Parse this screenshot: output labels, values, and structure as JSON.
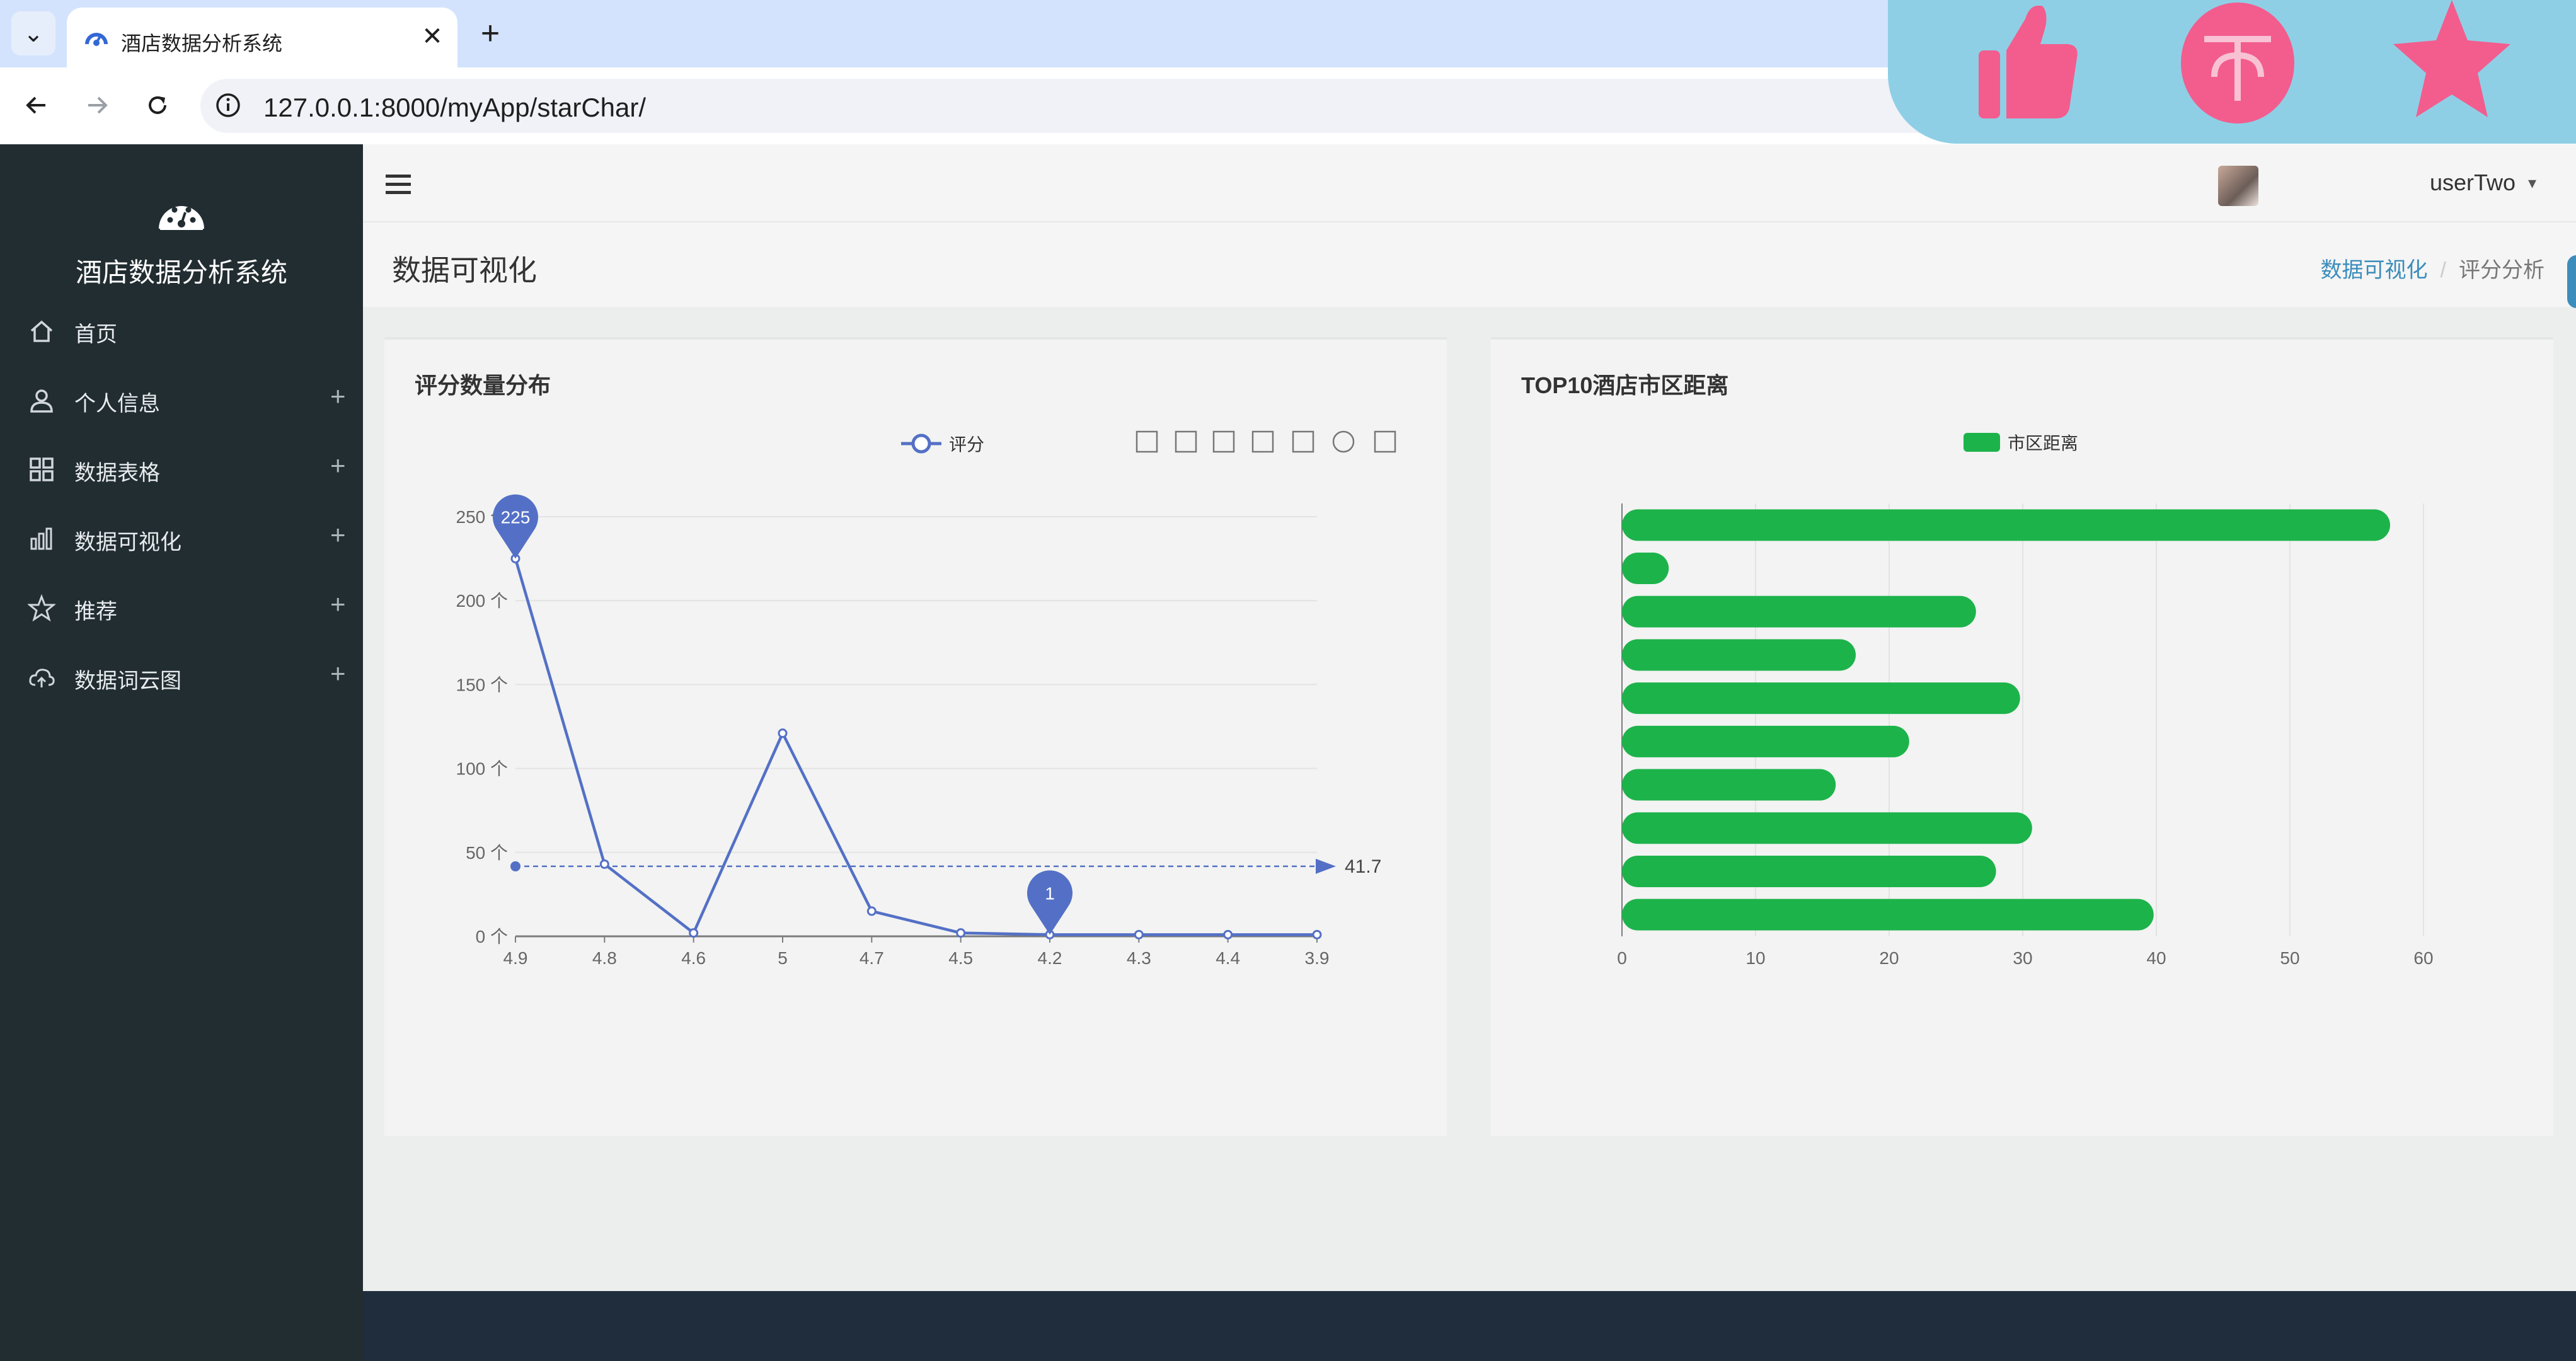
{
  "browser": {
    "tab_title": "酒店数据分析系统",
    "tab_close": "✕",
    "new_tab": "+",
    "url": "127.0.0.1:8000/myApp/starChar/"
  },
  "sidebar": {
    "brand": "酒店数据分析系统",
    "items": [
      {
        "label": "首页",
        "icon": "home-icon",
        "expandable": false
      },
      {
        "label": "个人信息",
        "icon": "user-icon",
        "expandable": true
      },
      {
        "label": "数据表格",
        "icon": "grid-icon",
        "expandable": true
      },
      {
        "label": "数据可视化",
        "icon": "bar-chart-icon",
        "expandable": true
      },
      {
        "label": "推荐",
        "icon": "star-icon",
        "expandable": true
      },
      {
        "label": "数据词云图",
        "icon": "cloud-upload-icon",
        "expandable": true
      }
    ],
    "plus": "+"
  },
  "header": {
    "username": "userTwo",
    "caret": "▾"
  },
  "content": {
    "page_title": "数据可视化",
    "breadcrumb": [
      "数据可视化",
      "评分分析"
    ],
    "breadcrumb_sep": "/"
  },
  "colors": {
    "sidebar_bg": "#222d32",
    "line_color": "#5470c6",
    "bar_color": "#1db34b",
    "link_color": "#3c8dbc",
    "reaction_bar": "#8fcfe6",
    "reaction_icon": "#f25d8e"
  },
  "reactions": [
    "thumbs-up-icon",
    "coin-icon",
    "favorite-star-icon"
  ],
  "chart_data": [
    {
      "type": "line",
      "title": "评分数量分布",
      "legend": [
        "评分"
      ],
      "legend_position": "top-center",
      "categories": [
        "4.9",
        "4.8",
        "4.6",
        "5",
        "4.7",
        "4.5",
        "4.2",
        "4.3",
        "4.4",
        "3.9"
      ],
      "series": [
        {
          "name": "评分",
          "values": [
            225,
            43,
            2,
            121,
            15,
            2,
            1,
            1,
            1,
            1
          ]
        }
      ],
      "ylim": [
        0,
        250
      ],
      "yticks": [
        "0 个",
        "50 个",
        "100 个",
        "150 个",
        "200 个",
        "250 个"
      ],
      "mark_points": [
        {
          "label": "225",
          "index": 0
        },
        {
          "label": "1",
          "index": 6
        }
      ],
      "mark_line": {
        "label": "41.7",
        "value": 41.7
      },
      "toolbox": [
        "zoom-icon",
        "zoom-reset-icon",
        "data-view-icon",
        "line-type-icon",
        "bar-type-icon",
        "restore-icon",
        "save-image-icon"
      ],
      "grid": "horizontal"
    },
    {
      "type": "bar",
      "orientation": "horizontal",
      "title": "TOP10酒店市区距离",
      "legend": [
        "市区距离"
      ],
      "legend_position": "top-center",
      "series": [
        {
          "name": "市区距离",
          "values": [
            57.5,
            3.5,
            26.5,
            17.5,
            29.8,
            21.5,
            16,
            30.7,
            28,
            39.8
          ]
        }
      ],
      "xlim": [
        0,
        60
      ],
      "xticks": [
        "0",
        "10",
        "20",
        "30",
        "40",
        "50",
        "60"
      ],
      "grid": "vertical"
    }
  ]
}
